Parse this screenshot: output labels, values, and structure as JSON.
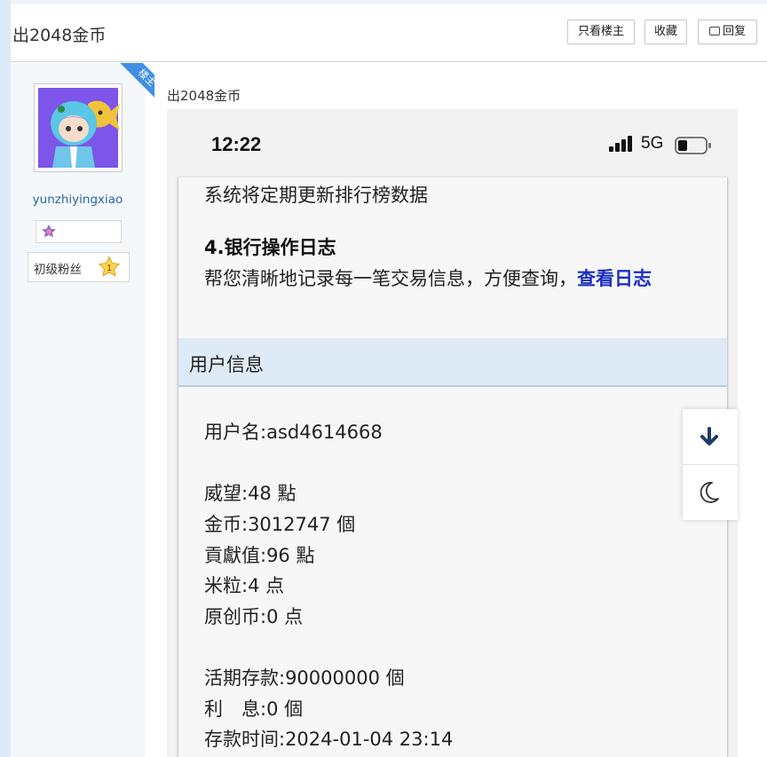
{
  "header": {
    "title": "出2048金币",
    "only_op_label": "只看楼主",
    "favorite_label": "收藏",
    "reply_label": "回复"
  },
  "sidebar": {
    "owner_badge": "楼主",
    "username": "yunzhiyingxiao",
    "rank_label": "初级粉丝",
    "rank_level": "1"
  },
  "post": {
    "title": "出2048金币"
  },
  "phone": {
    "status_time": "12:22",
    "network": "5G",
    "lines": {
      "update_note": "系统将定期更新排行榜数据",
      "section4_title": "4.银行操作日志",
      "section4_desc": "帮您清晰地记录每一笔交易信息，方便查询，",
      "section4_link": "查看日志",
      "userinfo_header": "用户信息",
      "username": "用户名:asd4614668",
      "prestige": "威望:48 點",
      "gold": "金币:3012747 個",
      "contribution": "貢獻值:96 點",
      "rice": "米粒:4 点",
      "original_coin": "原创币:0 点",
      "demand_deposit": "活期存款:90000000 個",
      "interest": "利　息:0 個",
      "deposit_time": "存款时间:2024-01-04 23:14"
    }
  },
  "colors": {
    "accent_blue": "#3f8fe3",
    "link": "#1a2fbf",
    "username": "#2a64a8",
    "userinfo_header_bg": "#deebf6"
  },
  "icons": {
    "scroll_down": "arrow-down-icon",
    "dark_mode": "moon-icon",
    "reply": "comment-icon"
  }
}
